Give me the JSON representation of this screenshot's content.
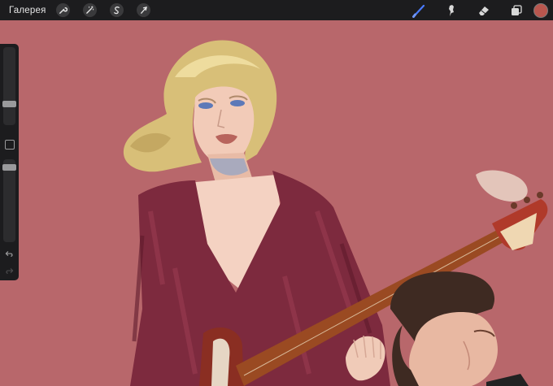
{
  "toolbar": {
    "gallery_label": "Галерея",
    "left_tools": [
      "wrench-icon",
      "magic-wand-icon",
      "selection-icon",
      "transform-arrow-icon"
    ],
    "right_tools": [
      "brush-icon",
      "smudge-icon",
      "eraser-icon",
      "layers-icon"
    ],
    "active_tool": "brush-icon",
    "accent_color": "#4a7bff",
    "current_color": "#b8564e"
  },
  "sidebar": {
    "brush_size_level": 0.72,
    "opacity_level": 0.08,
    "modify_button": "square-icon",
    "undo": "undo-icon",
    "redo": "redo-icon"
  },
  "canvas": {
    "background_color": "#b8676b",
    "artwork": "digital-painting"
  }
}
